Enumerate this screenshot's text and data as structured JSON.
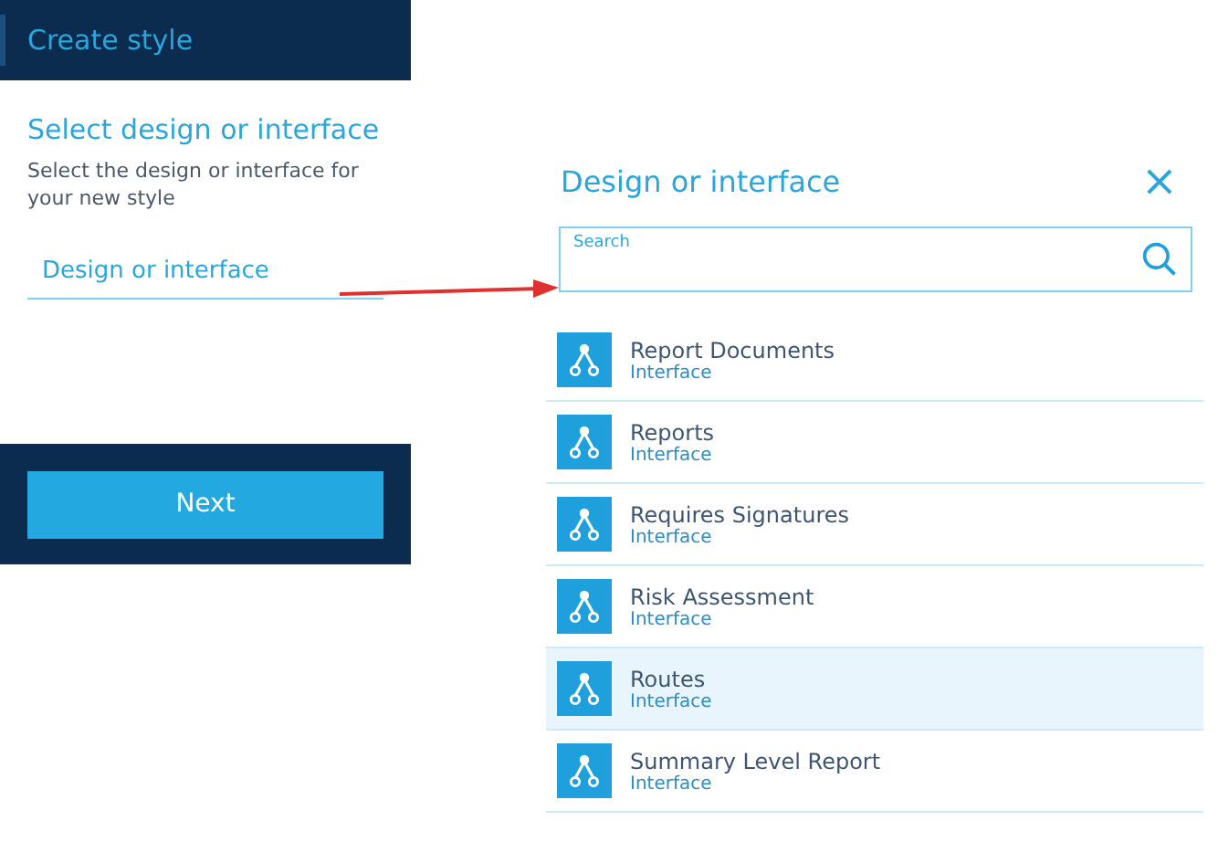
{
  "wizard": {
    "title": "Create style",
    "heading": "Select design or interface",
    "description": "Select the design or interface for your new style",
    "field": {
      "placeholder": "Design or interface"
    },
    "next_button": "Next"
  },
  "picker": {
    "title": "Design or interface",
    "close": "×",
    "search": {
      "label": "Search"
    },
    "items": [
      {
        "name": "Report Documents",
        "type": "Interface",
        "selected": false
      },
      {
        "name": "Reports",
        "type": "Interface",
        "selected": false
      },
      {
        "name": "Requires Signatures",
        "type": "Interface",
        "selected": false
      },
      {
        "name": "Risk Assessment",
        "type": "Interface",
        "selected": false
      },
      {
        "name": "Routes",
        "type": "Interface",
        "selected": true
      },
      {
        "name": "Summary Level Report",
        "type": "Interface",
        "selected": false
      }
    ]
  }
}
